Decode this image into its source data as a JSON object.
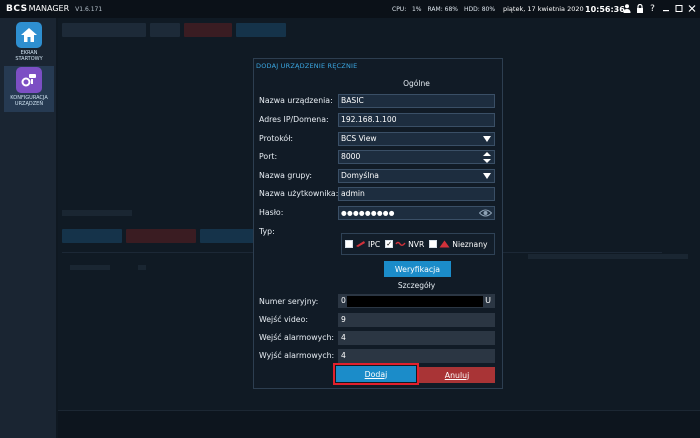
{
  "titlebar": {
    "brand_bold": "BCS",
    "brand_rest": "MANAGER",
    "version": "V1.6.171",
    "cpu_label": "CPU:",
    "cpu_value": "1%",
    "ram_label": "RAM:",
    "ram_value": "68%",
    "hdd_label": "HDD:",
    "hdd_value": "80%",
    "date": "piątek, 17 kwietnia 2020",
    "time": "10:56:36",
    "icons": [
      "user-icon",
      "lock-icon",
      "help-icon",
      "minimize-icon",
      "maximize-icon",
      "close-icon"
    ]
  },
  "sidebar": {
    "items": [
      {
        "label_line1": "EKRAN",
        "label_line2": "STARTOWY",
        "icon": "home-icon"
      },
      {
        "label_line1": "KONFIGURACJA",
        "label_line2": "URZĄDZEŃ",
        "icon": "devices-config-icon"
      }
    ]
  },
  "dialog": {
    "title": "DODAJ URZĄDZENIE RĘCZNIE",
    "section_general": "Ogólne",
    "fields": {
      "device_name": {
        "label": "Nazwa urządzenia:",
        "value": "BASIC"
      },
      "address": {
        "label": "Adres IP/Domena:",
        "value": "192.168.1.100"
      },
      "protocol": {
        "label": "Protokół:",
        "value": "BCS View"
      },
      "port": {
        "label": "Port:",
        "value": "8000"
      },
      "group": {
        "label": "Nazwa grupy:",
        "value": "Domyślna"
      },
      "username": {
        "label": "Nazwa użytkownika:",
        "value": "admin"
      },
      "password": {
        "label": "Hasło:",
        "value": "●●●●●●●●●"
      }
    },
    "type": {
      "label": "Typ:",
      "options": [
        {
          "name": "IPC",
          "checked": false
        },
        {
          "name": "NVR",
          "checked": true
        },
        {
          "name": "Nieznany",
          "checked": false
        }
      ]
    },
    "verify_button": "Weryfikacja",
    "section_details": "Szczegóły",
    "details": {
      "serial": {
        "label": "Numer seryjny:",
        "value_start": "0",
        "value_end": "U"
      },
      "video_inputs": {
        "label": "Wejść video:",
        "value": "9"
      },
      "alarm_inputs": {
        "label": "Wejść alarmowych:",
        "value": "4"
      },
      "alarm_outputs": {
        "label": "Wyjść alarmowych:",
        "value": "4"
      }
    },
    "add_button": "Dodaj",
    "cancel_button": "Anuluj"
  },
  "colors": {
    "accent": "#1b8cc9",
    "cancel": "#a93436",
    "highlight": "#e2202c",
    "dialog_bg": "#111b26",
    "title": "#3ba7e2"
  }
}
